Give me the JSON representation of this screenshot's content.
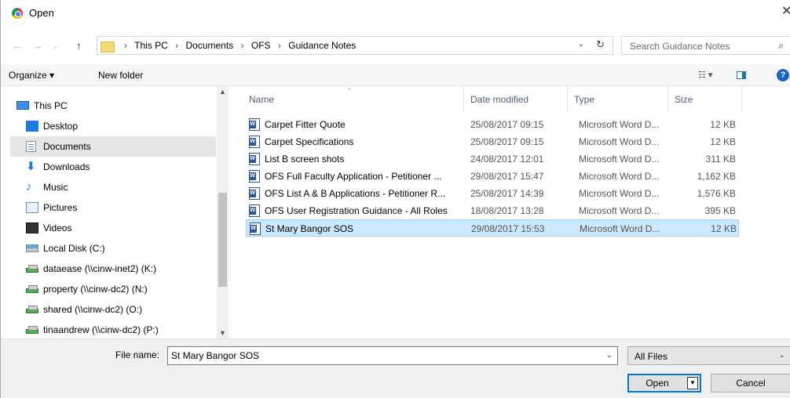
{
  "window": {
    "title": "Open",
    "app_icon": "chrome-icon"
  },
  "address": {
    "crumbs": [
      "This PC",
      "Documents",
      "OFS",
      "Guidance Notes"
    ]
  },
  "search": {
    "placeholder": "Search Guidance Notes"
  },
  "toolbar": {
    "organize": "Organize ▾",
    "new_folder": "New folder"
  },
  "nav": {
    "items": [
      {
        "label": "This PC",
        "icon": "computer-icon"
      },
      {
        "label": "Desktop",
        "icon": "desktop-icon"
      },
      {
        "label": "Documents",
        "icon": "documents-icon",
        "selected": true
      },
      {
        "label": "Downloads",
        "icon": "downloads-icon"
      },
      {
        "label": "Music",
        "icon": "music-icon"
      },
      {
        "label": "Pictures",
        "icon": "pictures-icon"
      },
      {
        "label": "Videos",
        "icon": "videos-icon"
      },
      {
        "label": "Local Disk (C:)",
        "icon": "local-disk-icon"
      },
      {
        "label": "dataease (\\\\cinw-inet2) (K:)",
        "icon": "network-drive-icon"
      },
      {
        "label": "property (\\\\cinw-dc2) (N:)",
        "icon": "network-drive-icon"
      },
      {
        "label": "shared (\\\\cinw-dc2) (O:)",
        "icon": "network-drive-icon"
      },
      {
        "label": "tinaandrew (\\\\cinw-dc2) (P:)",
        "icon": "network-drive-icon"
      }
    ]
  },
  "columns": {
    "name": "Name",
    "date": "Date modified",
    "type": "Type",
    "size": "Size"
  },
  "files": [
    {
      "name": "Carpet Fitter Quote",
      "date": "25/08/2017 09:15",
      "type": "Microsoft Word D...",
      "size": "12 KB"
    },
    {
      "name": "Carpet Specifications",
      "date": "25/08/2017 09:15",
      "type": "Microsoft Word D...",
      "size": "12 KB"
    },
    {
      "name": "List B screen shots",
      "date": "24/08/2017 12:01",
      "type": "Microsoft Word D...",
      "size": "311 KB"
    },
    {
      "name": "OFS Full Faculty Application - Petitioner ...",
      "date": "29/08/2017 15:47",
      "type": "Microsoft Word D...",
      "size": "1,162 KB"
    },
    {
      "name": "OFS List A & B Applications - Petitioner R...",
      "date": "25/08/2017 14:39",
      "type": "Microsoft Word D...",
      "size": "1,576 KB"
    },
    {
      "name": "OFS User Registration Guidance - All Roles",
      "date": "18/08/2017 13:28",
      "type": "Microsoft Word D...",
      "size": "395 KB"
    },
    {
      "name": "St Mary Bangor SOS",
      "date": "29/08/2017 15:53",
      "type": "Microsoft Word D...",
      "size": "12 KB",
      "selected": true
    }
  ],
  "footer": {
    "file_name_label": "File name:",
    "file_name_value": "St Mary Bangor SOS",
    "filter_value": "All Files",
    "open_label": "Open",
    "cancel_label": "Cancel"
  }
}
